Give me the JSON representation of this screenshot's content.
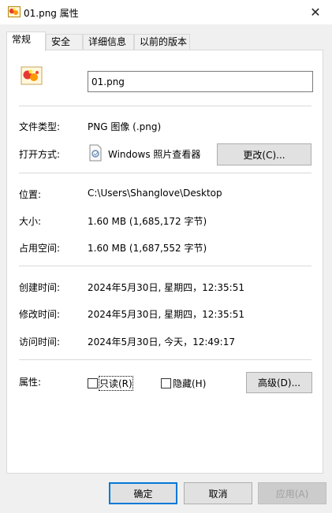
{
  "window": {
    "title": "01.png 属性",
    "close_glyph": "✕"
  },
  "tabs": [
    {
      "label": "常规",
      "active": true
    },
    {
      "label": "安全"
    },
    {
      "label": "详细信息"
    },
    {
      "label": "以前的版本"
    }
  ],
  "general": {
    "file_name": "01.png",
    "file_type_label": "文件类型:",
    "file_type_value": "PNG 图像 (.png)",
    "open_with_label": "打开方式:",
    "open_with_app": "Windows 照片查看器",
    "change_button": "更改(C)...",
    "location_label": "位置:",
    "location_value": "C:\\Users\\Shanglove\\Desktop",
    "size_label": "大小:",
    "size_value": "1.60 MB (1,685,172 字节)",
    "size_on_disk_label": "占用空间:",
    "size_on_disk_value": "1.60 MB (1,687,552 字节)",
    "created_label": "创建时间:",
    "created_value": "2024年5月30日, 星期四，12:35:51",
    "modified_label": "修改时间:",
    "modified_value": "2024年5月30日, 星期四，12:35:51",
    "accessed_label": "访问时间:",
    "accessed_value": "2024年5月30日, 今天，12:49:17",
    "attributes_label": "属性:",
    "readonly_label": "只读(R)",
    "readonly_checked": false,
    "hidden_label": "隐藏(H)",
    "hidden_checked": false,
    "advanced_button": "高级(D)..."
  },
  "footer": {
    "ok": "确定",
    "cancel": "取消",
    "apply": "应用(A)"
  },
  "colors": {
    "accent": "#0078d7",
    "panel_bg": "#ffffff",
    "window_bg": "#f0f0f0"
  },
  "icons": {
    "title": "image-file-icon",
    "file": "image-file-icon",
    "app": "photo-viewer-icon"
  }
}
